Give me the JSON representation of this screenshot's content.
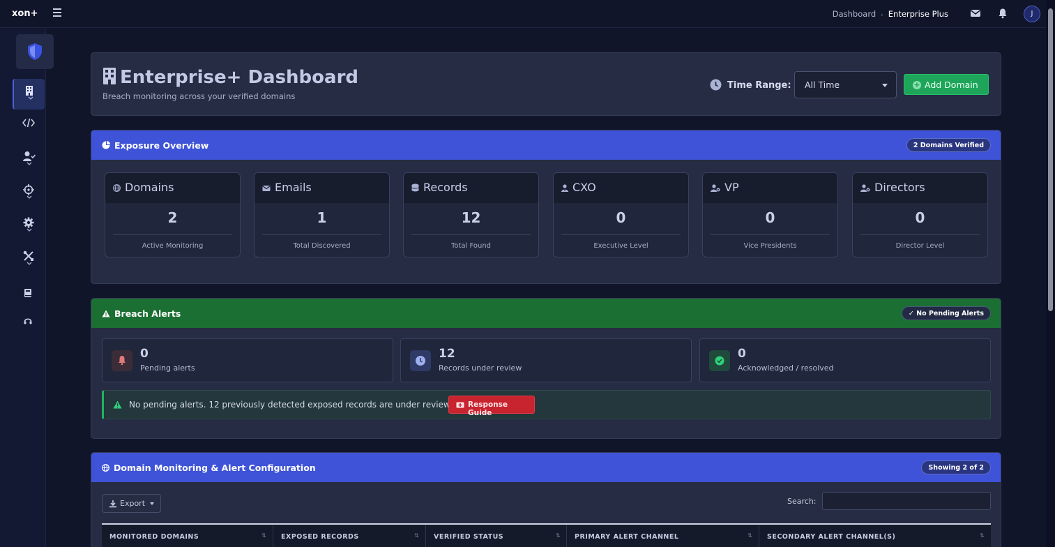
{
  "topbar": {
    "brand": "xon+",
    "breadcrumb": [
      "Dashboard",
      "Enterprise Plus"
    ],
    "avatar_initial": "J"
  },
  "header": {
    "title": "Enterprise+ Dashboard",
    "subtitle": "Breach monitoring across your verified domains",
    "time_range_label": "Time Range:",
    "time_range_value": "All Time",
    "add_domain_label": "Add Domain"
  },
  "exposure": {
    "title": "Exposure Overview",
    "badge": "2 Domains Verified",
    "stats": [
      {
        "label": "Domains",
        "value": "2",
        "caption": "Active Monitoring"
      },
      {
        "label": "Emails",
        "value": "1",
        "caption": "Total Discovered"
      },
      {
        "label": "Records",
        "value": "12",
        "caption": "Total Found"
      },
      {
        "label": "CXO",
        "value": "0",
        "caption": "Executive Level"
      },
      {
        "label": "VP",
        "value": "0",
        "caption": "Vice Presidents"
      },
      {
        "label": "Directors",
        "value": "0",
        "caption": "Director Level"
      }
    ]
  },
  "breach": {
    "title": "Breach Alerts",
    "badge": "✓ No Pending Alerts",
    "alerts": [
      {
        "value": "0",
        "label": "Pending alerts"
      },
      {
        "value": "12",
        "label": "Records under review"
      },
      {
        "value": "0",
        "label": "Acknowledged / resolved"
      }
    ],
    "notice": "No pending alerts. 12 previously detected exposed records are under review.",
    "response_guide_label": "Response Guide"
  },
  "domains": {
    "title": "Domain Monitoring & Alert Configuration",
    "badge": "Showing 2 of 2",
    "export_label": "Export",
    "search_label": "Search:",
    "columns": [
      "MONITORED DOMAINS",
      "EXPOSED RECORDS",
      "VERIFIED STATUS",
      "PRIMARY ALERT CHANNEL",
      "SECONDARY ALERT CHANNEL(S)"
    ]
  },
  "colors": {
    "page_bg": "#11152a",
    "card_bg": "#262c43",
    "blue_header": "#3e53d7",
    "green_header": "#1b6f32",
    "add_button": "#1ea55a",
    "response_button": "#c8242f"
  }
}
